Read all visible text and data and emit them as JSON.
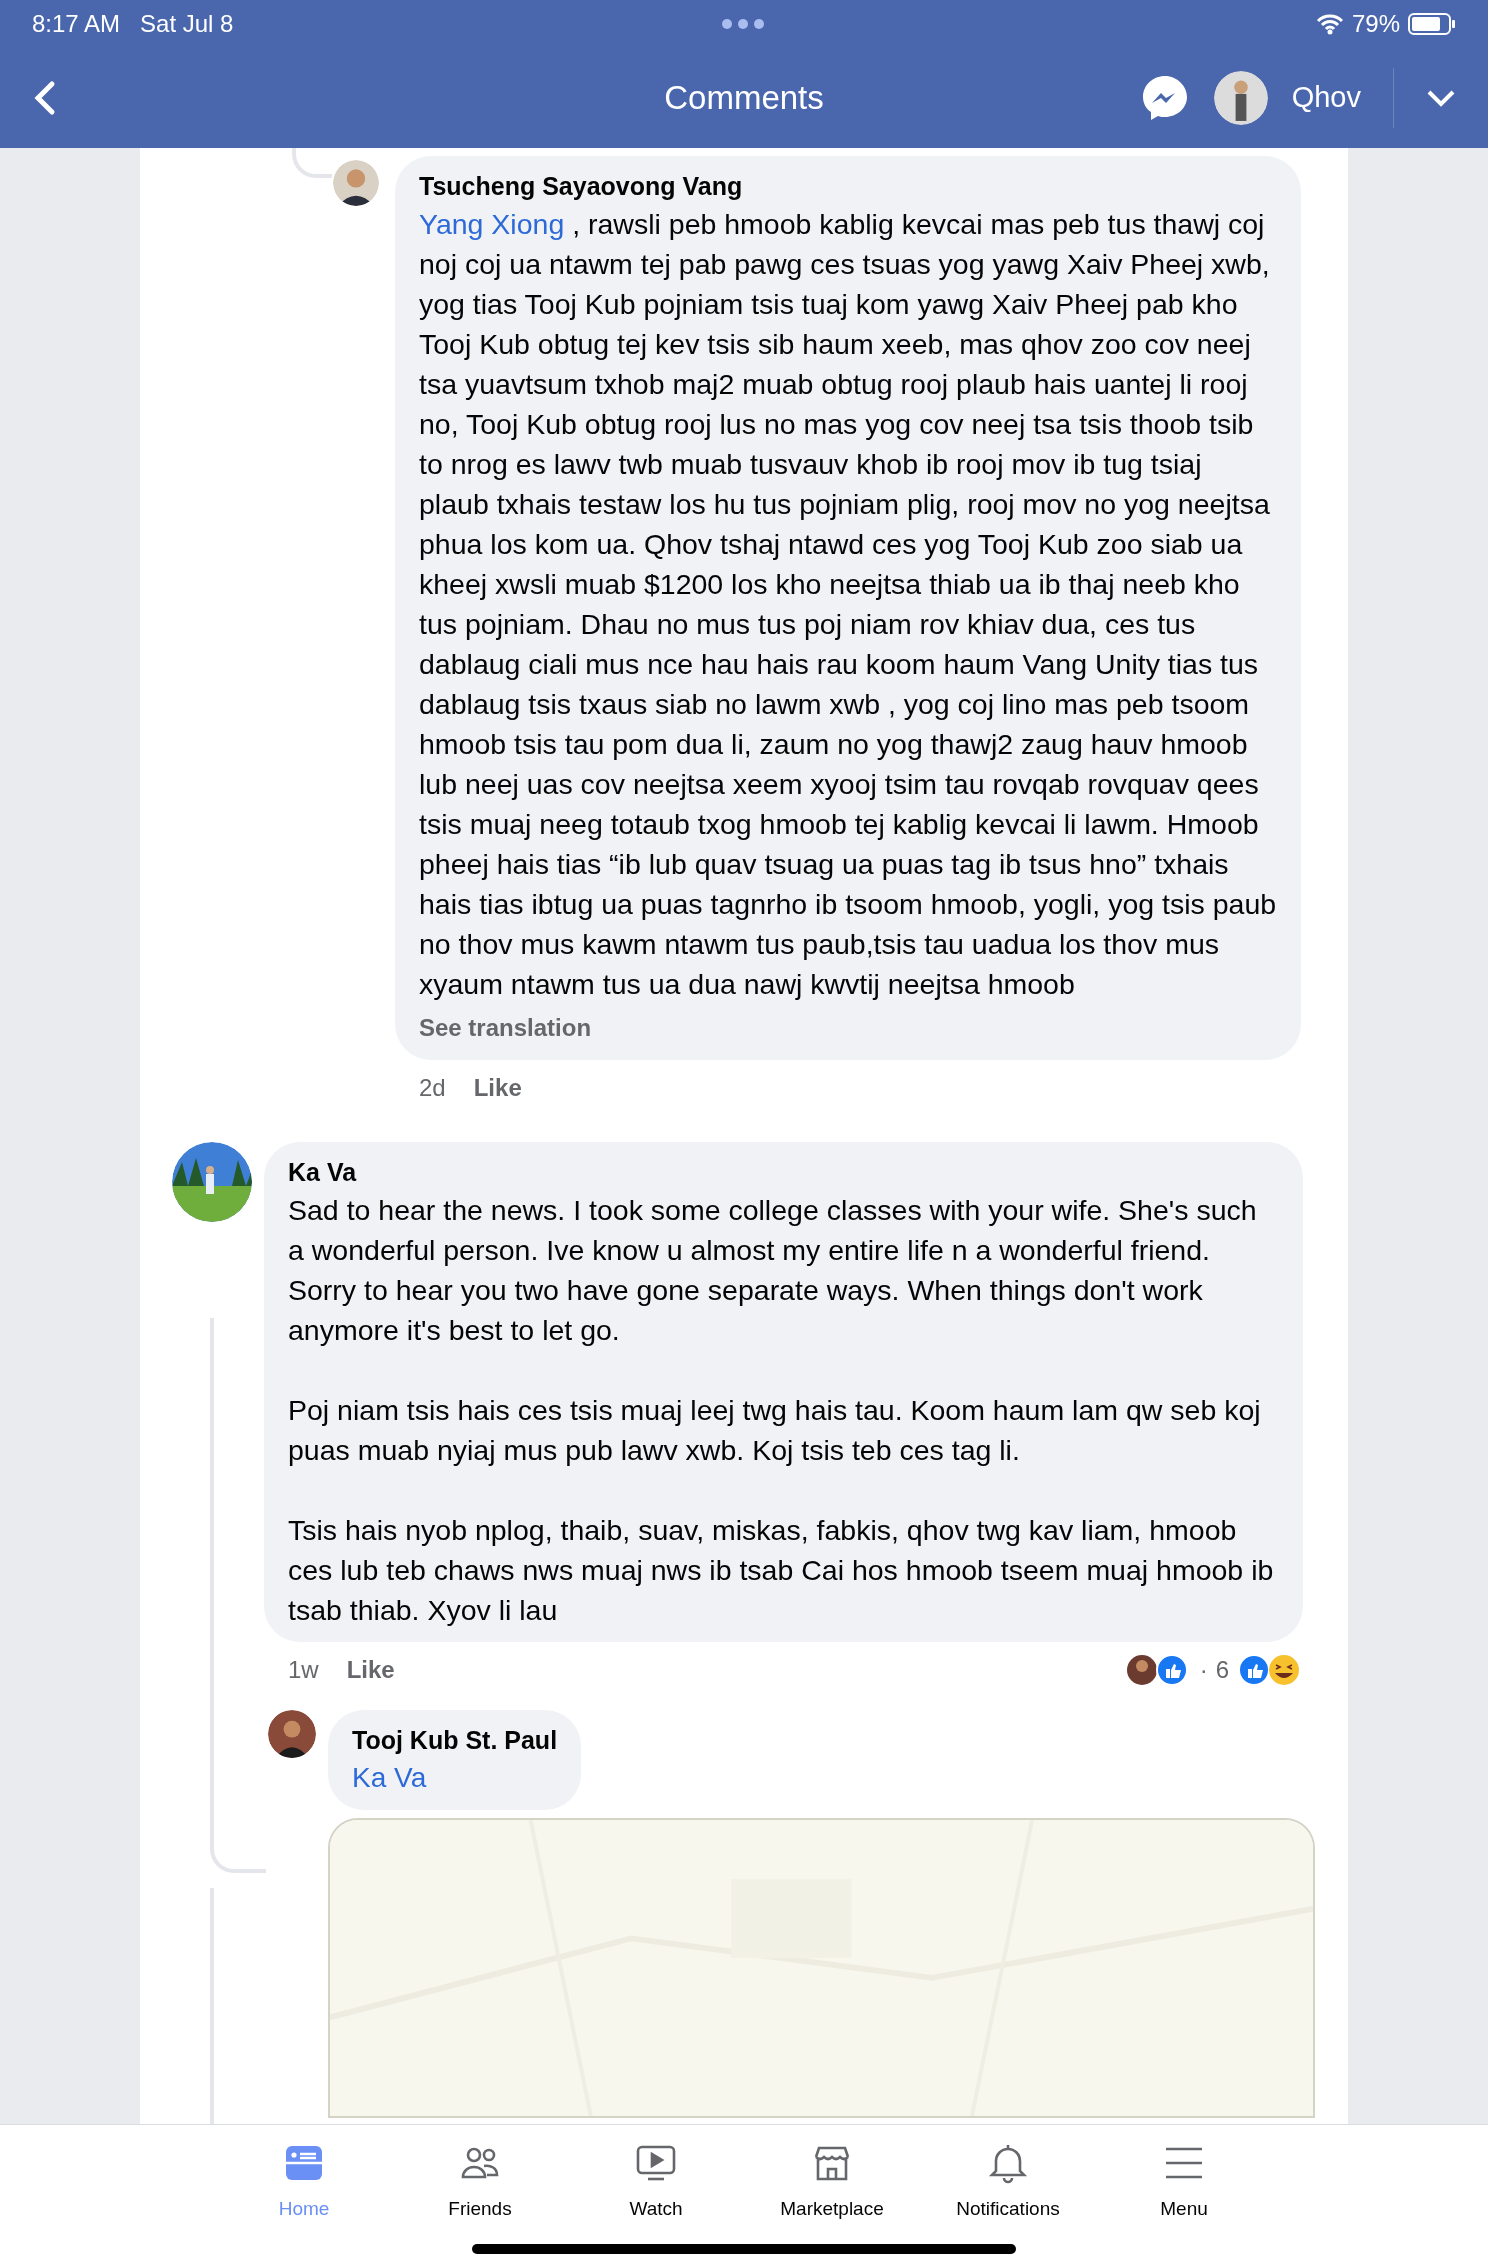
{
  "status_bar": {
    "time": "8:17 AM",
    "date": "Sat Jul 8",
    "battery": "79%"
  },
  "nav": {
    "title": "Comments",
    "user": "Qhov"
  },
  "comments": [
    {
      "author": "Tsucheng Sayaovong Vang",
      "mention": "Yang Xiong",
      "paragraphs": [
        ", rawsli peb hmoob kablig kevcai mas peb tus thawj coj noj coj ua ntawm tej pab pawg ces tsuas yog yawg Xaiv Pheej xwb, yog tias Tooj Kub pojniam tsis tuaj kom yawg Xaiv Pheej pab kho Tooj Kub obtug tej kev tsis sib haum xeeb, mas qhov zoo cov neej tsa yuavtsum txhob maj2 muab obtug rooj plaub hais uantej li rooj no, Tooj Kub obtug rooj lus no mas yog cov neej tsa tsis thoob tsib to nrog es lawv twb muab tusvauv khob ib rooj mov ib tug tsiaj plaub txhais testaw los hu tus pojniam plig, rooj mov no yog neejtsa phua los kom ua. Qhov tshaj ntawd ces yog Tooj Kub zoo siab ua kheej xwsli muab $1200 los kho neejtsa thiab ua ib thaj neeb kho tus pojniam. Dhau no mus tus poj niam rov khiav dua, ces tus dablaug ciali mus nce hau hais rau koom haum Vang Unity tias tus dablaug tsis txaus siab no lawm xwb , yog coj lino mas peb tsoom hmoob tsis tau pom dua li, zaum no yog thawj2 zaug hauv hmoob lub neej uas cov neejtsa xeem xyooj tsim tau rovqab rovquav qees tsis muaj neeg totaub txog hmoob tej kablig kevcai li lawm. Hmoob pheej hais tias “ib lub quav tsuag ua puas tag ib tsus hno” txhais hais tias ibtug ua puas tagnrho ib tsoom hmoob, yogli, yog tsis paub no thov mus kawm ntawm tus paub,tsis tau uadua los thov mus xyaum ntawm tus ua dua nawj kwvtij neejtsa hmoob"
      ],
      "translation": "See translation",
      "time": "2d",
      "like": "Like"
    },
    {
      "author": "Ka Va",
      "paragraphs": [
        "Sad to hear the news. I took some college classes with your wife.  She's such a wonderful person.  Ive know u almost my entire life n a wonderful friend. Sorry to hear you two have gone separate ways. When things don't work anymore it's best to let go.",
        "Poj niam tsis hais ces tsis muaj leej twg hais tau. Koom haum lam qw seb koj puas muab nyiaj mus pub lawv xwb. Koj tsis teb ces tag li.",
        "Tsis hais nyob nplog, thaib, suav, miskas, fabkis, qhov twg kav liam, hmoob ces lub teb chaws nws muaj nws ib tsab Cai hos hmoob tseem muaj hmoob ib tsab thiab. Xyov li lau"
      ],
      "time": "1w",
      "like": "Like",
      "reactions": {
        "separator": "·",
        "count": "6"
      }
    },
    {
      "author": "Tooj Kub St. Paul",
      "mention": "Ka Va"
    }
  ],
  "tabs": [
    {
      "label": "Home",
      "selected": true
    },
    {
      "label": "Friends",
      "selected": false
    },
    {
      "label": "Watch",
      "selected": false
    },
    {
      "label": "Marketplace",
      "selected": false
    },
    {
      "label": "Notifications",
      "selected": false
    },
    {
      "label": "Menu",
      "selected": false
    }
  ]
}
